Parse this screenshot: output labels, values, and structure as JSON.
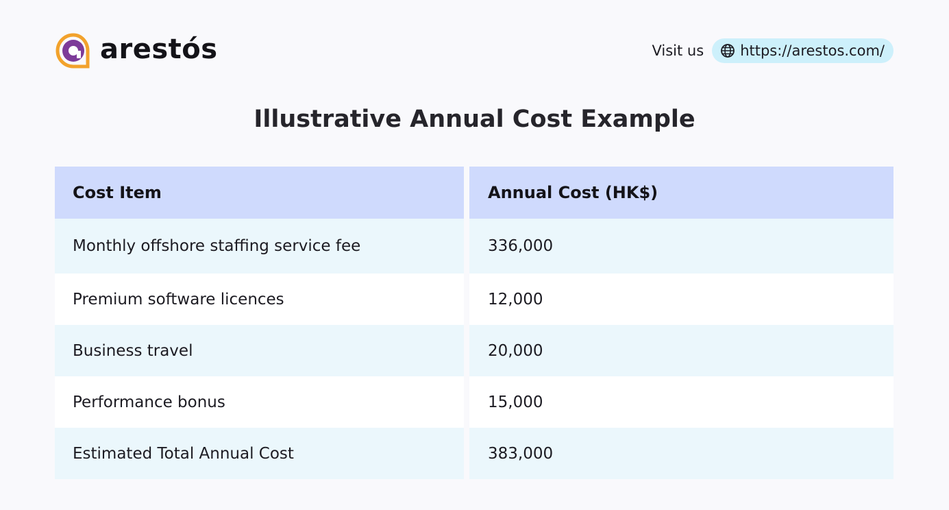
{
  "brand": {
    "name": "arestós",
    "colors": {
      "ring": "#f2a22c",
      "letter": "#7d3b99",
      "accent": "#cdf0fb",
      "header_row": "#cfdafd",
      "tinted_row": "#ebf7fc"
    }
  },
  "header": {
    "visit_label": "Visit us",
    "url_icon": "globe-icon",
    "url": "https://arestos.com/"
  },
  "title": "Illustrative Annual Cost Example",
  "table": {
    "columns": [
      "Cost Item",
      "Annual Cost (HK$)"
    ],
    "rows": [
      {
        "item": "Monthly offshore staffing service fee",
        "cost": "336,000"
      },
      {
        "item": "Premium software licences",
        "cost": "12,000"
      },
      {
        "item": "Business travel",
        "cost": "20,000"
      },
      {
        "item": "Performance bonus",
        "cost": "15,000"
      },
      {
        "item": "Estimated Total Annual Cost",
        "cost": "383,000"
      }
    ]
  }
}
